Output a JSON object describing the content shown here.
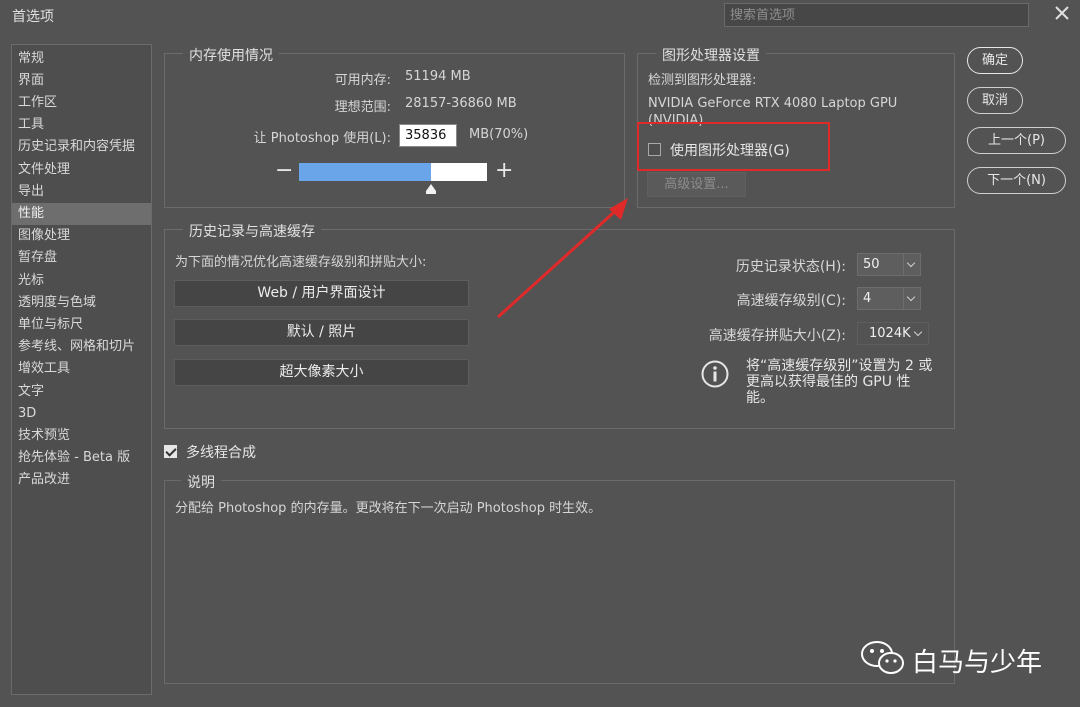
{
  "window": {
    "title": "首选项",
    "search_placeholder": "搜索首选项"
  },
  "sidebar": {
    "items": [
      "常规",
      "界面",
      "工作区",
      "工具",
      "历史记录和内容凭据",
      "文件处理",
      "导出",
      "性能",
      "图像处理",
      "暂存盘",
      "光标",
      "透明度与色域",
      "单位与标尺",
      "参考线、网格和切片",
      "增效工具",
      "文字",
      "3D",
      "技术预览",
      "抢先体验 - Beta 版",
      "产品改进"
    ],
    "active": "性能"
  },
  "memory": {
    "title": "内存使用情况",
    "available_label": "可用内存:",
    "available_value": "51194 MB",
    "ideal_label": "理想范围:",
    "ideal_value": "28157-36860 MB",
    "use_label": "让 Photoshop 使用(L):",
    "use_value": "35836",
    "use_suffix": "MB(70%)",
    "slider_fraction": 0.7,
    "minus": "−",
    "plus": "+"
  },
  "gpu": {
    "title": "图形处理器设置",
    "detected_label": "检测到图形处理器:",
    "gpu_name_line1": "NVIDIA GeForce RTX 4080 Laptop GPU",
    "gpu_name_line2": "(NVIDIA)",
    "use_gpu_label": "使用图形处理器(G)",
    "use_gpu_checked": false,
    "advanced_button": "高级设置..."
  },
  "history_cache": {
    "title": "历史记录与高速缓存",
    "optimize_label": "为下面的情况优化高速缓存级别和拼贴大小:",
    "preset_buttons": [
      "Web / 用户界面设计",
      "默认 / 照片",
      "超大像素大小"
    ],
    "history_states_label": "历史记录状态(H):",
    "history_states_value": "50",
    "cache_levels_label": "高速缓存级别(C):",
    "cache_levels_value": "4",
    "cache_tile_label": "高速缓存拼贴大小(Z):",
    "cache_tile_value": "1024K",
    "info_line1": "将“高速缓存级别”设置为 2 或",
    "info_line2": "更高以获得最佳的 GPU 性",
    "info_line3": "能。"
  },
  "multithread": {
    "label": "多线程合成",
    "checked": true
  },
  "description": {
    "title": "说明",
    "text": "分配给 Photoshop 的内存量。更改将在下一次启动 Photoshop 时生效。"
  },
  "buttons": {
    "ok": "确定",
    "cancel": "取消",
    "prev": "上一个(P)",
    "next": "下一个(N)"
  },
  "watermark": {
    "text": "白马与少年"
  },
  "colors": {
    "slider_fill": "#6aa5ea",
    "annotation_red": "#e02a2a",
    "background": "#535353"
  }
}
